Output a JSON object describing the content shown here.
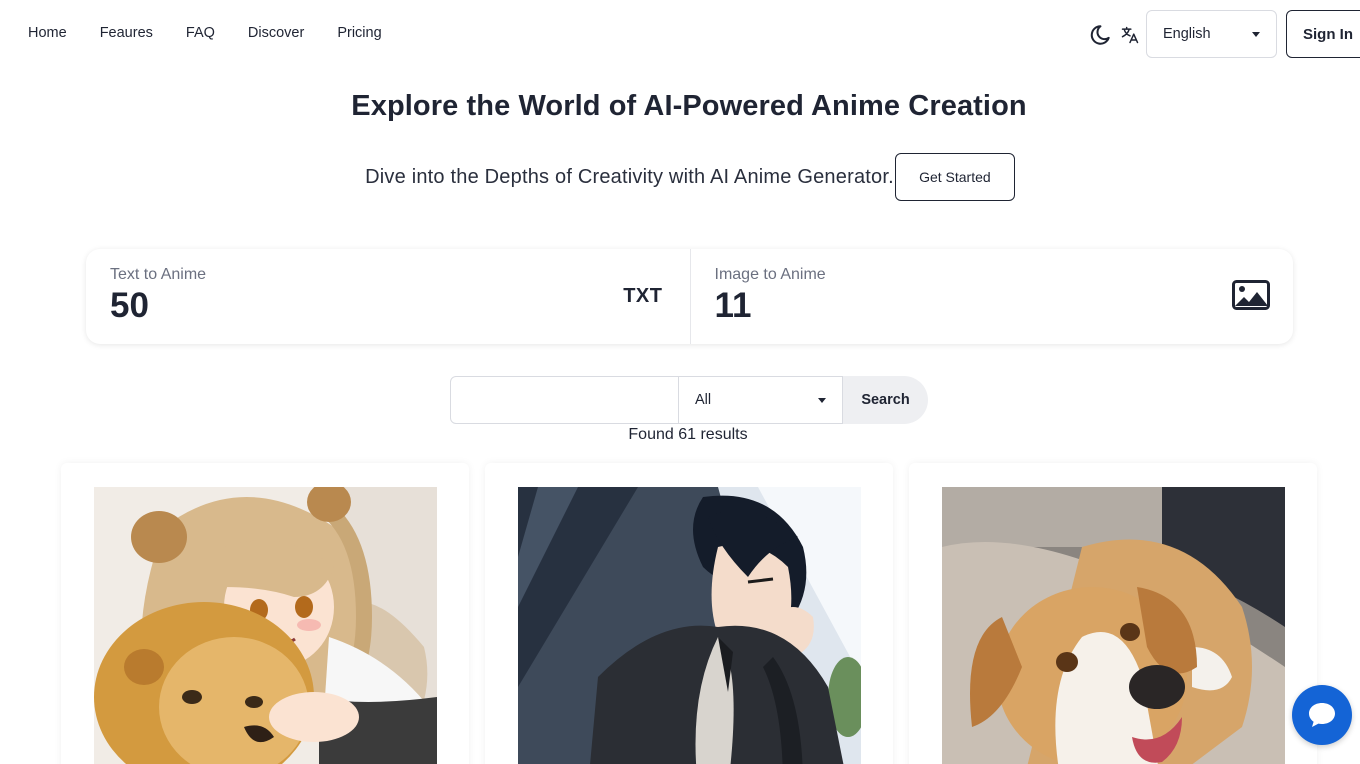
{
  "nav": {
    "links": [
      "Home",
      "Feaures",
      "FAQ",
      "Discover",
      "Pricing"
    ],
    "language": "English",
    "signin_label": "Sign In"
  },
  "hero": {
    "title": "Explore the World of AI-Powered Anime Creation",
    "subtitle": "Dive into the Depths of Creativity with AI Anime Generator.",
    "cta_label": "Get Started"
  },
  "stats": [
    {
      "label": "Text to Anime",
      "value": "50",
      "icon": "TXT"
    },
    {
      "label": "Image to Anime",
      "value": "11",
      "icon": "image-icon"
    }
  ],
  "search": {
    "placeholder": "",
    "filter": "All",
    "button_label": "Search",
    "results_text": "Found 61 results"
  },
  "gallery": [
    {
      "subject": "girl-with-lion"
    },
    {
      "subject": "boy-in-hoodie"
    },
    {
      "subject": "beagle-dog"
    }
  ],
  "colors": {
    "accent": "#1464d6",
    "text": "#1f2433",
    "border": "#d9dbe1"
  }
}
